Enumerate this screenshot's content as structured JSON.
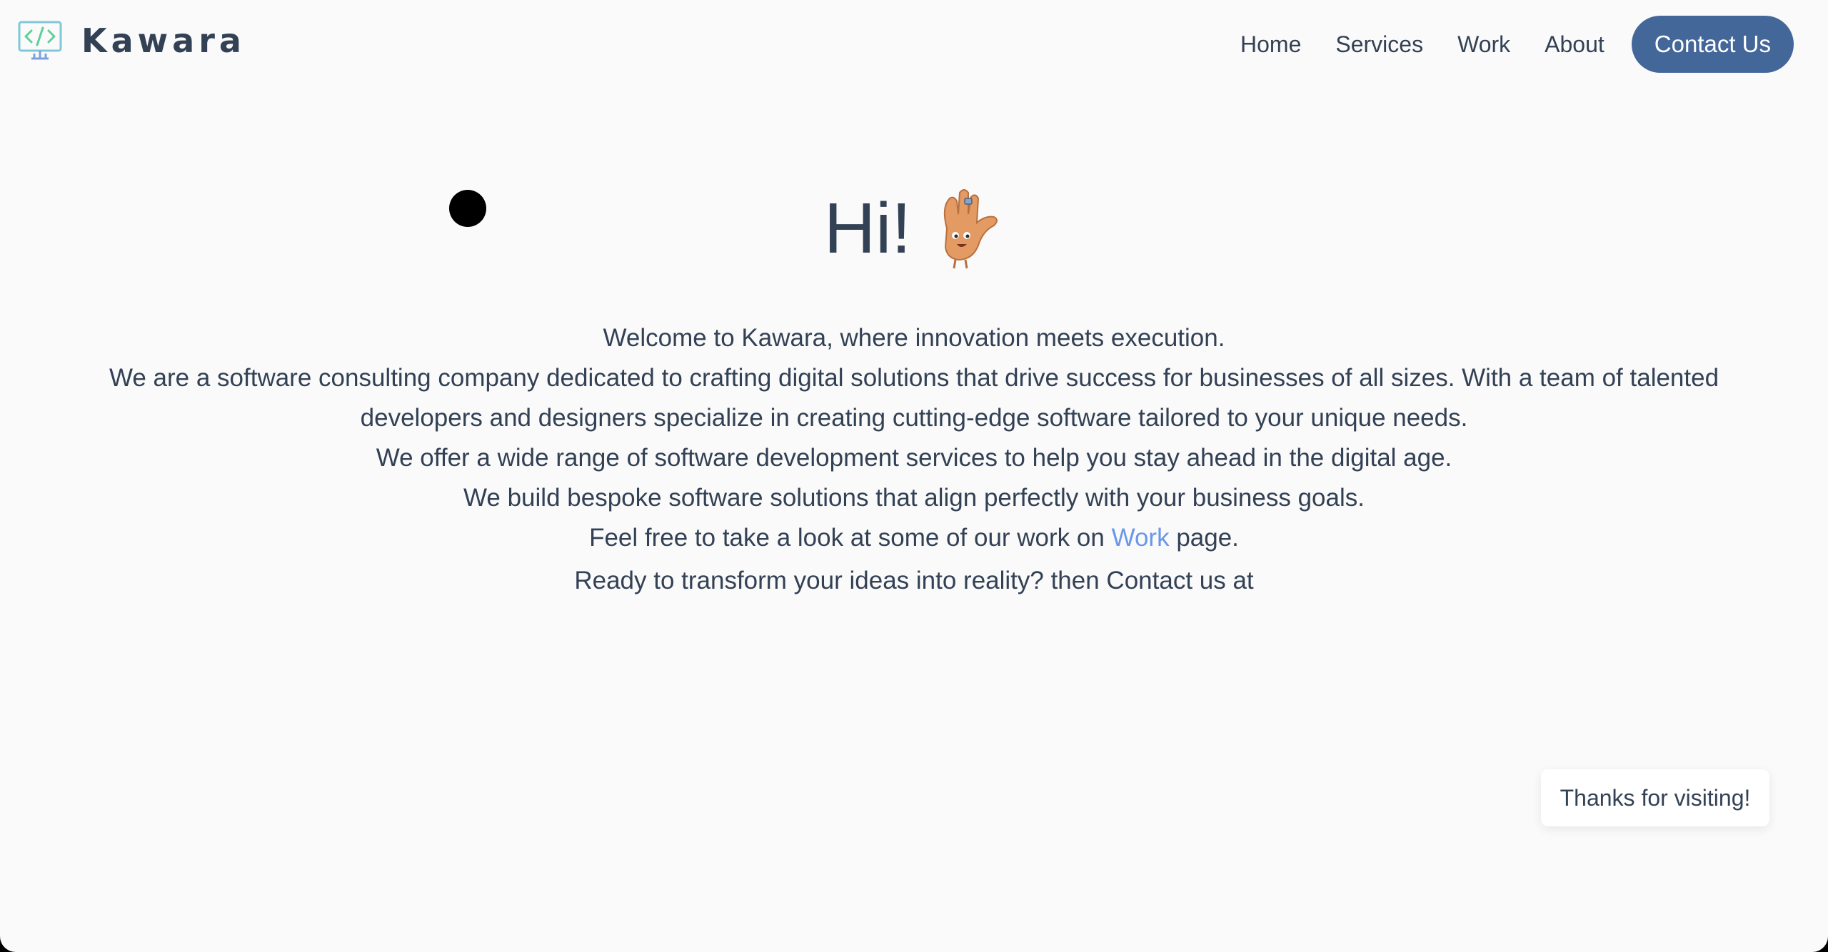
{
  "brand": {
    "name": "Kawara",
    "icon": "code-monitor-icon"
  },
  "nav": {
    "items": [
      {
        "label": "Home"
      },
      {
        "label": "Services"
      },
      {
        "label": "Work"
      },
      {
        "label": "About"
      }
    ],
    "contact_label": "Contact Us",
    "accent_color": "#44679a"
  },
  "hero": {
    "title": "Hi!",
    "emoji_icon": "waving-hand-icon",
    "lines": [
      "Welcome to Kawara, where innovation meets execution.",
      "We are a software consulting company dedicated to crafting digital solutions that drive success for businesses of all sizes. With a team of talented developers and designers specialize in creating cutting-edge software tailored to your unique needs.",
      "We offer a wide range of software development services to help you stay ahead in the digital age.",
      "We build bespoke software solutions that align perfectly with your business goals."
    ],
    "work_line": {
      "before": "Feel free to take a look at some of our work on ",
      "link": "Work",
      "after": " page."
    },
    "contact_line": "Ready to transform your ideas into reality? then Contact us at",
    "link_color": "#6a97e8"
  },
  "toast": {
    "message": "Thanks for visiting!"
  }
}
